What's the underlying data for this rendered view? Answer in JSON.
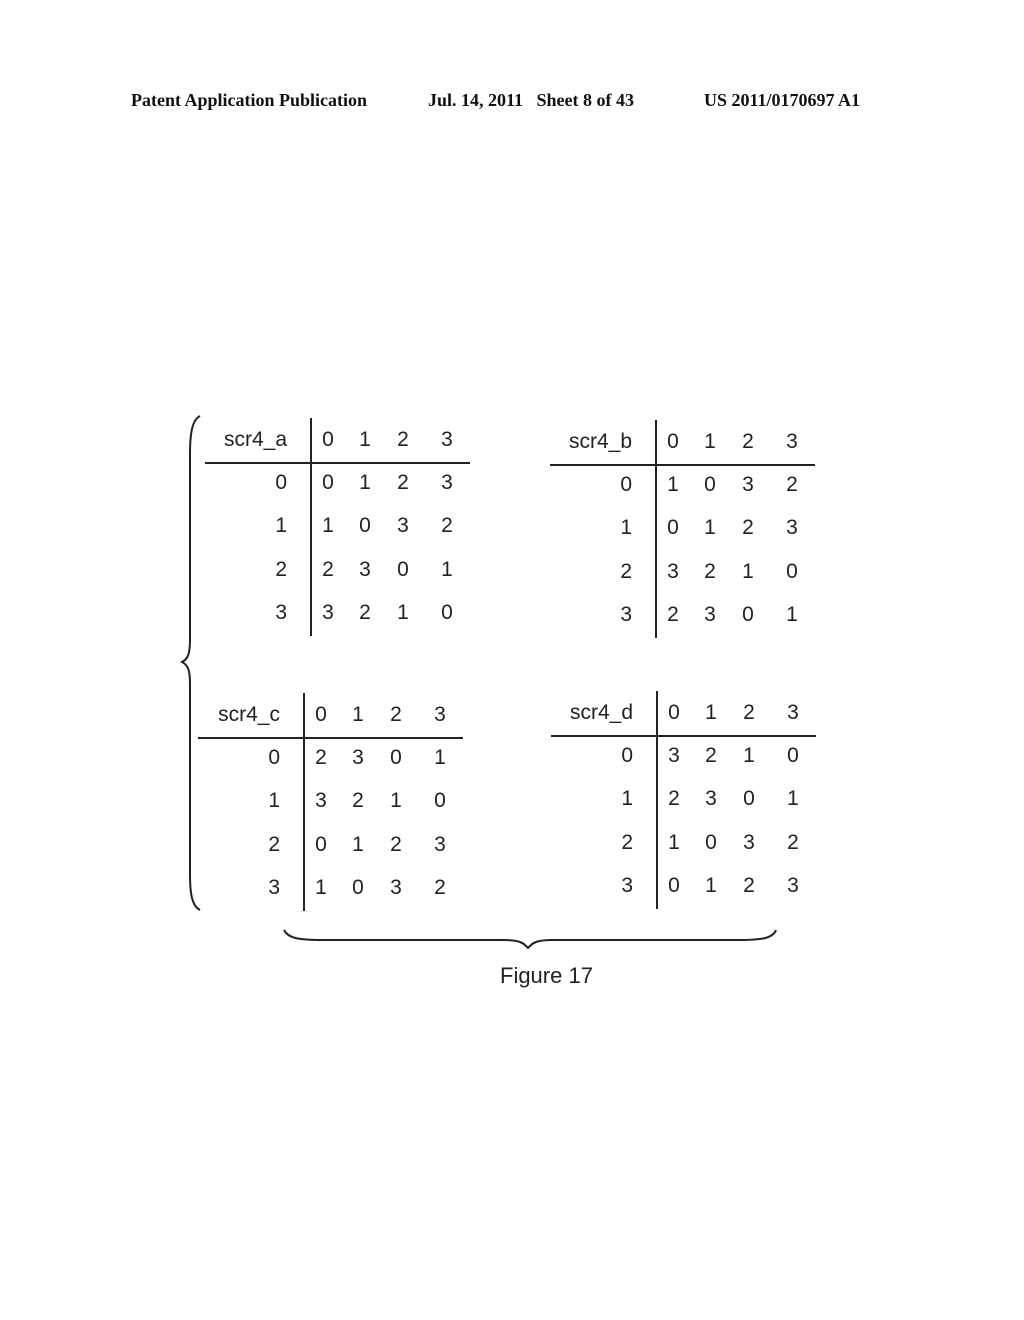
{
  "header": {
    "publication": "Patent Application Publication",
    "date_sheet": "Jul. 14, 2011   Sheet 8 of 43",
    "number": "US 2011/0170697 A1"
  },
  "figure": {
    "caption": "Figure 17",
    "tables": [
      {
        "name": "scr4_a",
        "col_headers": [
          "0",
          "1",
          "2",
          "3"
        ],
        "row_headers": [
          "0",
          "1",
          "2",
          "3"
        ],
        "rows": [
          [
            "0",
            "1",
            "2",
            "3"
          ],
          [
            "1",
            "0",
            "3",
            "2"
          ],
          [
            "2",
            "3",
            "0",
            "1"
          ],
          [
            "3",
            "2",
            "1",
            "0"
          ]
        ]
      },
      {
        "name": "scr4_b",
        "col_headers": [
          "0",
          "1",
          "2",
          "3"
        ],
        "row_headers": [
          "0",
          "1",
          "2",
          "3"
        ],
        "rows": [
          [
            "1",
            "0",
            "3",
            "2"
          ],
          [
            "0",
            "1",
            "2",
            "3"
          ],
          [
            "3",
            "2",
            "1",
            "0"
          ],
          [
            "2",
            "3",
            "0",
            "1"
          ]
        ]
      },
      {
        "name": "scr4_c",
        "col_headers": [
          "0",
          "1",
          "2",
          "3"
        ],
        "row_headers": [
          "0",
          "1",
          "2",
          "3"
        ],
        "rows": [
          [
            "2",
            "3",
            "0",
            "1"
          ],
          [
            "3",
            "2",
            "1",
            "0"
          ],
          [
            "0",
            "1",
            "2",
            "3"
          ],
          [
            "1",
            "0",
            "3",
            "2"
          ]
        ]
      },
      {
        "name": "scr4_d",
        "col_headers": [
          "0",
          "1",
          "2",
          "3"
        ],
        "row_headers": [
          "0",
          "1",
          "2",
          "3"
        ],
        "rows": [
          [
            "3",
            "2",
            "1",
            "0"
          ],
          [
            "2",
            "3",
            "0",
            "1"
          ],
          [
            "1",
            "0",
            "3",
            "2"
          ],
          [
            "0",
            "1",
            "2",
            "3"
          ]
        ]
      }
    ]
  }
}
